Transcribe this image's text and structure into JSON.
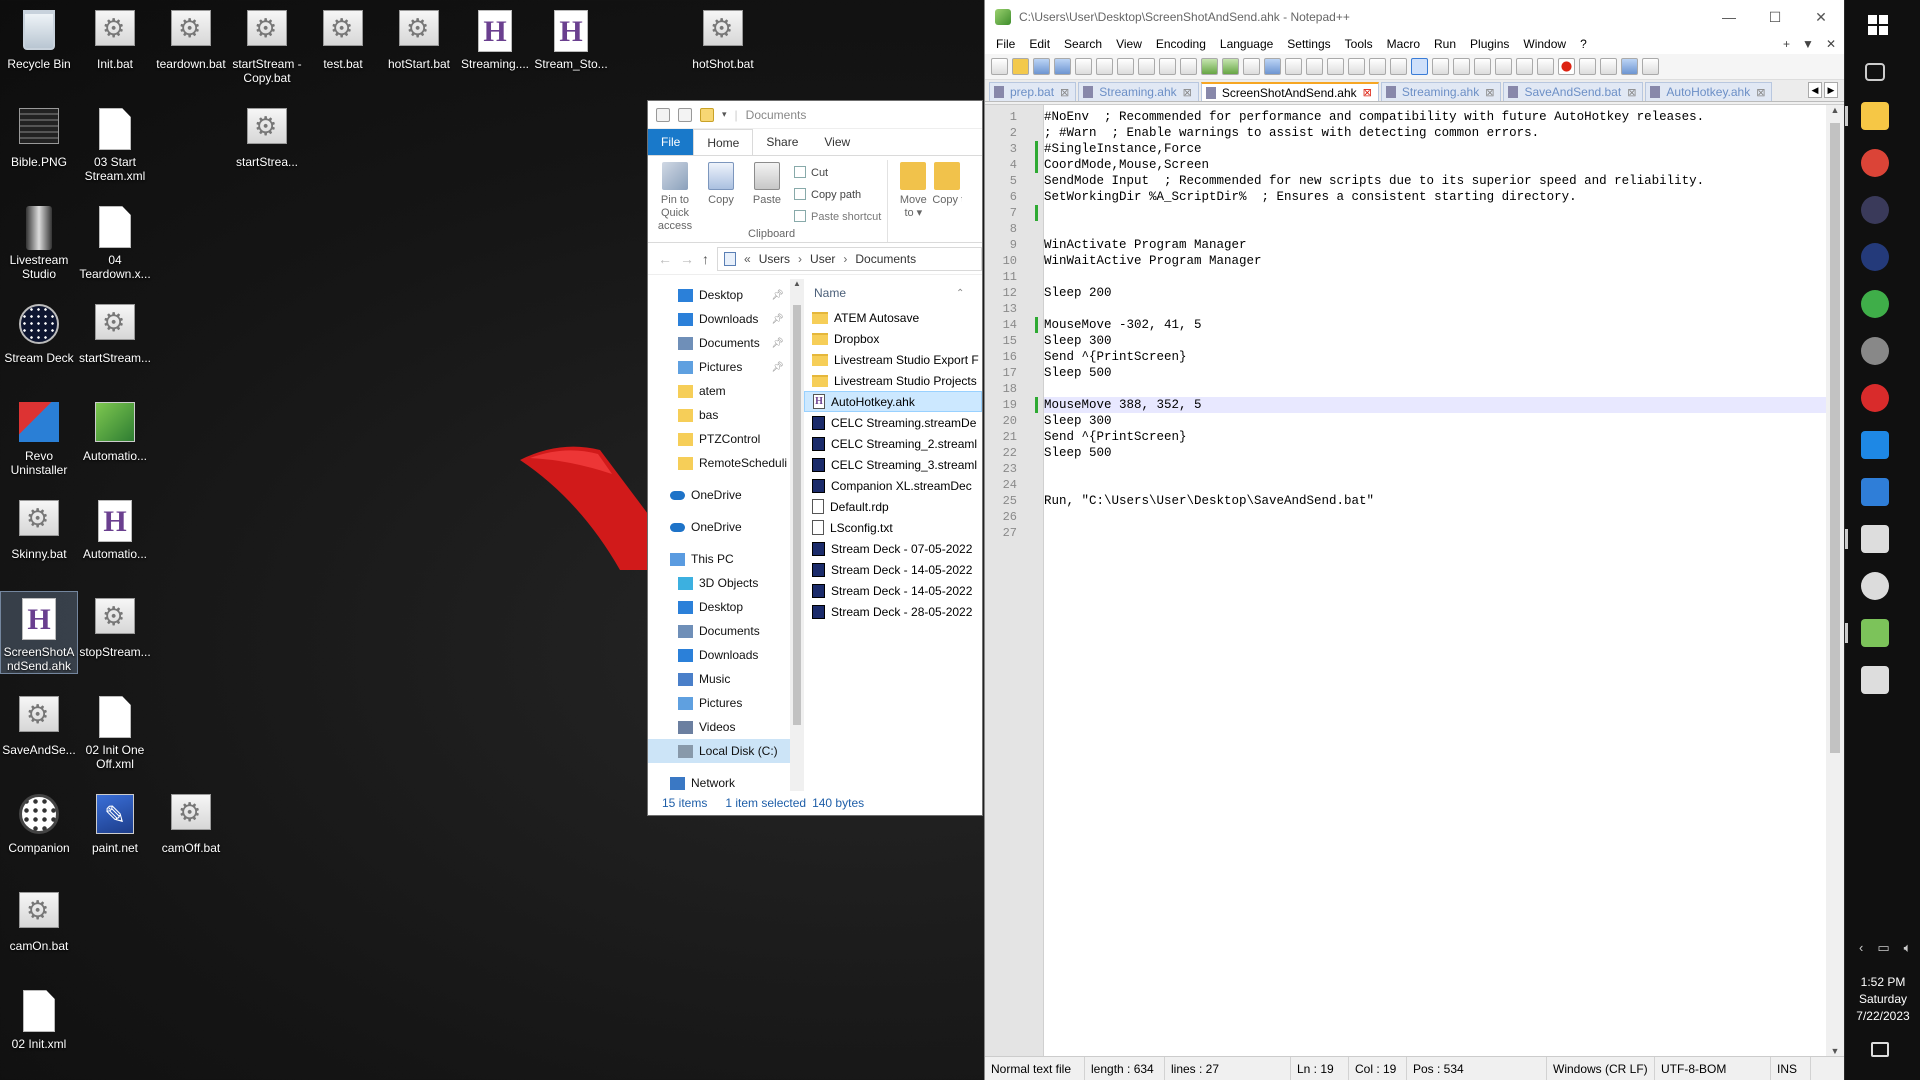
{
  "desktop": {
    "icons": [
      {
        "label": "Recycle Bin",
        "kind": "recycle"
      },
      {
        "label": "Init.bat",
        "kind": "bat"
      },
      {
        "label": "teardown.bat",
        "kind": "bat"
      },
      {
        "label": "startStream - Copy.bat",
        "kind": "bat"
      },
      {
        "label": "test.bat",
        "kind": "bat"
      },
      {
        "label": "hotStart.bat",
        "kind": "bat"
      },
      {
        "label": "Streaming....",
        "kind": "ahk"
      },
      {
        "label": "Stream_Sto...",
        "kind": "ahk"
      },
      {
        "label": "hotShot.bat",
        "kind": "bat"
      },
      {
        "label": "Bible.PNG",
        "kind": "png"
      },
      {
        "label": "03 Start Stream.xml",
        "kind": "file"
      },
      {
        "label": "startStrea...",
        "kind": "bat"
      },
      {
        "label": "Livestream Studio",
        "kind": "livestream"
      },
      {
        "label": "04 Teardown.x...",
        "kind": "file"
      },
      {
        "label": "Stream Deck",
        "kind": "streamdeck"
      },
      {
        "label": "startStream...",
        "kind": "bat"
      },
      {
        "label": "Revo Uninstaller",
        "kind": "revo"
      },
      {
        "label": "Automatio...",
        "kind": "automation"
      },
      {
        "label": "Skinny.bat",
        "kind": "bat"
      },
      {
        "label": "Automatio...",
        "kind": "ahk"
      },
      {
        "label": "ScreenShotAndSend.ahk",
        "kind": "ahk",
        "selected": true
      },
      {
        "label": "stopStream...",
        "kind": "bat"
      },
      {
        "label": "SaveAndSe...",
        "kind": "bat"
      },
      {
        "label": "02 Init One Off.xml",
        "kind": "file"
      },
      {
        "label": "Companion",
        "kind": "companion"
      },
      {
        "label": "paint.net",
        "kind": "paint"
      },
      {
        "label": "camOff.bat",
        "kind": "bat"
      },
      {
        "label": "camOn.bat",
        "kind": "bat"
      },
      {
        "label": "02 Init.xml",
        "kind": "file"
      }
    ]
  },
  "explorer": {
    "title": "Documents",
    "tabs": [
      "File",
      "Home",
      "Share",
      "View"
    ],
    "active_tab": "Home",
    "ribbon": {
      "pin_label": "Pin to Quick access",
      "copy_label": "Copy",
      "paste_label": "Paste",
      "cut_label": "Cut",
      "copy_path_label": "Copy path",
      "paste_shortcut_label": "Paste shortcut",
      "move_to_label": "Move to",
      "copy_to_label": "Copy to",
      "group_label": "Clipboard"
    },
    "breadcrumb": [
      "Users",
      "User",
      "Documents"
    ],
    "nav": [
      {
        "label": "Desktop",
        "icon": "desktop",
        "pinned": true,
        "indent": 1
      },
      {
        "label": "Downloads",
        "icon": "download",
        "pinned": true,
        "indent": 1
      },
      {
        "label": "Documents",
        "icon": "documents",
        "pinned": true,
        "indent": 1
      },
      {
        "label": "Pictures",
        "icon": "pictures",
        "pinned": true,
        "indent": 1
      },
      {
        "label": "atem",
        "icon": "folder",
        "indent": 1
      },
      {
        "label": "bas",
        "icon": "folder",
        "indent": 1
      },
      {
        "label": "PTZControl",
        "icon": "folder",
        "indent": 1
      },
      {
        "label": "RemoteScheduli",
        "icon": "folder",
        "indent": 1
      },
      {
        "label": "OneDrive",
        "icon": "onedrive",
        "indent": 0,
        "gap": true
      },
      {
        "label": "OneDrive",
        "icon": "onedrive",
        "indent": 0,
        "gap": true
      },
      {
        "label": "This PC",
        "icon": "pc",
        "indent": 0,
        "gap": true
      },
      {
        "label": "3D Objects",
        "icon": "3d",
        "indent": 1
      },
      {
        "label": "Desktop",
        "icon": "desktop",
        "indent": 1
      },
      {
        "label": "Documents",
        "icon": "documents",
        "indent": 1
      },
      {
        "label": "Downloads",
        "icon": "download",
        "indent": 1
      },
      {
        "label": "Music",
        "icon": "music",
        "indent": 1
      },
      {
        "label": "Pictures",
        "icon": "pictures",
        "indent": 1
      },
      {
        "label": "Videos",
        "icon": "videos",
        "indent": 1
      },
      {
        "label": "Local Disk (C:)",
        "icon": "disk",
        "indent": 1,
        "selected": true
      },
      {
        "label": "Network",
        "icon": "network",
        "indent": 0,
        "gap": true
      }
    ],
    "column_name": "Name",
    "files": [
      {
        "name": "ATEM Autosave",
        "kind": "folder"
      },
      {
        "name": "Dropbox",
        "kind": "folder"
      },
      {
        "name": "Livestream Studio Export F",
        "kind": "folder"
      },
      {
        "name": "Livestream Studio Projects",
        "kind": "folder"
      },
      {
        "name": "AutoHotkey.ahk",
        "kind": "ahk",
        "selected": true
      },
      {
        "name": "CELC Streaming.streamDe",
        "kind": "sd"
      },
      {
        "name": "CELC Streaming_2.streaml",
        "kind": "sd"
      },
      {
        "name": "CELC Streaming_3.streaml",
        "kind": "sd"
      },
      {
        "name": "Companion XL.streamDec",
        "kind": "sd"
      },
      {
        "name": "Default.rdp",
        "kind": "doc"
      },
      {
        "name": "LSconfig.txt",
        "kind": "doc"
      },
      {
        "name": "Stream Deck - 07-05-2022",
        "kind": "sd"
      },
      {
        "name": "Stream Deck - 14-05-2022",
        "kind": "sd"
      },
      {
        "name": "Stream Deck - 14-05-2022",
        "kind": "sd"
      },
      {
        "name": "Stream Deck - 28-05-2022",
        "kind": "sd"
      }
    ],
    "status": {
      "count": "15 items",
      "selected": "1 item selected",
      "size": "140 bytes"
    }
  },
  "npp": {
    "title": "C:\\Users\\User\\Desktop\\ScreenShotAndSend.ahk - Notepad++",
    "menus": [
      "File",
      "Edit",
      "Search",
      "View",
      "Encoding",
      "Language",
      "Settings",
      "Tools",
      "Macro",
      "Run",
      "Plugins",
      "Window",
      "?"
    ],
    "menu_right": [
      "+",
      "▼",
      "✕"
    ],
    "tabs": [
      {
        "label": "prep.bat"
      },
      {
        "label": "Streaming.ahk"
      },
      {
        "label": "ScreenShotAndSend.ahk",
        "active": true
      },
      {
        "label": "Streaming.ahk"
      },
      {
        "label": "SaveAndSend.bat"
      },
      {
        "label": "AutoHotkey.ahk"
      }
    ],
    "current_line": 19,
    "changed_lines": [
      3,
      4,
      7,
      14,
      19
    ],
    "lines": [
      "#NoEnv  ; Recommended for performance and compatibility with future AutoHotkey releases.",
      "; #Warn  ; Enable warnings to assist with detecting common errors.",
      "#SingleInstance,Force",
      "CoordMode,Mouse,Screen",
      "SendMode Input  ; Recommended for new scripts due to its superior speed and reliability.",
      "SetWorkingDir %A_ScriptDir%  ; Ensures a consistent starting directory.",
      "",
      "",
      "WinActivate Program Manager",
      "WinWaitActive Program Manager",
      "",
      "Sleep 200",
      "",
      "MouseMove -302, 41, 5",
      "Sleep 300",
      "Send ^{PrintScreen}",
      "Sleep 500",
      "",
      "MouseMove 388, 352, 5",
      "Sleep 300",
      "Send ^{PrintScreen}",
      "Sleep 500",
      "",
      "",
      "Run, \"C:\\Users\\User\\Desktop\\SaveAndSend.bat\"",
      "",
      ""
    ],
    "status": {
      "type": "Normal text file",
      "length": "length : 634",
      "lines": "lines : 27",
      "ln": "Ln : 19",
      "col": "Col : 19",
      "pos": "Pos : 534",
      "eol": "Windows (CR LF)",
      "encoding": "UTF-8-BOM",
      "mode": "INS"
    }
  },
  "taskbar": {
    "apps": [
      {
        "name": "windows-start-icon",
        "color": "#ffffff"
      },
      {
        "name": "task-view-icon",
        "color": "#cccccc"
      },
      {
        "name": "file-explorer-icon",
        "color": "#f6c745",
        "running": true
      },
      {
        "name": "chrome-icon",
        "color": "#db4437"
      },
      {
        "name": "obs-icon",
        "color": "#3a3a5a"
      },
      {
        "name": "stream-deck-icon",
        "color": "#243a7a"
      },
      {
        "name": "upload-icon",
        "color": "#3fae49"
      },
      {
        "name": "globe-icon",
        "color": "#888888"
      },
      {
        "name": "record-icon",
        "color": "#d92b2b"
      },
      {
        "name": "vscode-icon",
        "color": "#1e88e5"
      },
      {
        "name": "puzzle-icon",
        "color": "#2f7ed8"
      },
      {
        "name": "notepad-icon",
        "color": "#dddddd",
        "running": true
      },
      {
        "name": "clock-app-icon",
        "color": "#dcdcdc"
      },
      {
        "name": "notepad-plus-plus-icon",
        "color": "#7cc35a",
        "running": true
      },
      {
        "name": "text-app-icon",
        "color": "#dddddd"
      }
    ],
    "time": "1:52 PM",
    "day": "Saturday",
    "date": "7/22/2023"
  }
}
